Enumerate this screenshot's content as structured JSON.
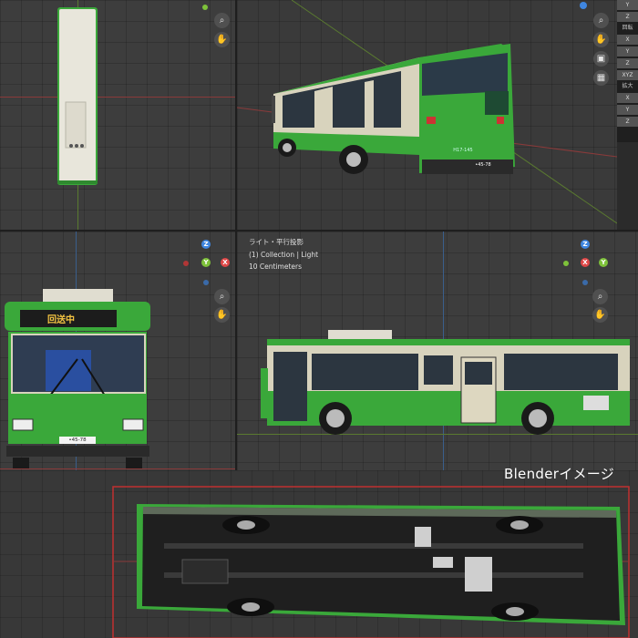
{
  "viewports": {
    "top_left": {},
    "top_right": {},
    "bottom_left": {
      "destination_sign": "回送中",
      "plate_text": "•45-78",
      "gizmo": {
        "z": "Z",
        "y": "Y",
        "x": "X"
      }
    },
    "bottom_right": {
      "overlay_lines": [
        "ライト・平行投影",
        "(1) Collection | Light",
        "10 Centimeters"
      ],
      "gizmo": {
        "z": "Z",
        "y": "Y",
        "x": "X"
      }
    },
    "top_right_gizmo": {
      "x": "X"
    }
  },
  "rear_plate": {
    "line1": "H17-145",
    "line2": "•45-78"
  },
  "n_panel": {
    "rows_top": [
      "Y",
      "Z"
    ],
    "rotation_label": "回転",
    "rotation_rows": [
      "X",
      "Y",
      "Z"
    ],
    "mode_label": "XYZ",
    "scale_label": "拡大",
    "scale_rows": [
      "X",
      "Y",
      "Z"
    ]
  },
  "caption": "Blenderイメージ",
  "icons": [
    "zoom-icon",
    "hand-icon",
    "camera-icon",
    "grid-icon"
  ],
  "colors": {
    "bus_green": "#3aa83a",
    "bus_cream": "#d8d3bd",
    "axis_x": "#e04848",
    "axis_y": "#7ec23a",
    "axis_z": "#3f86e0"
  }
}
